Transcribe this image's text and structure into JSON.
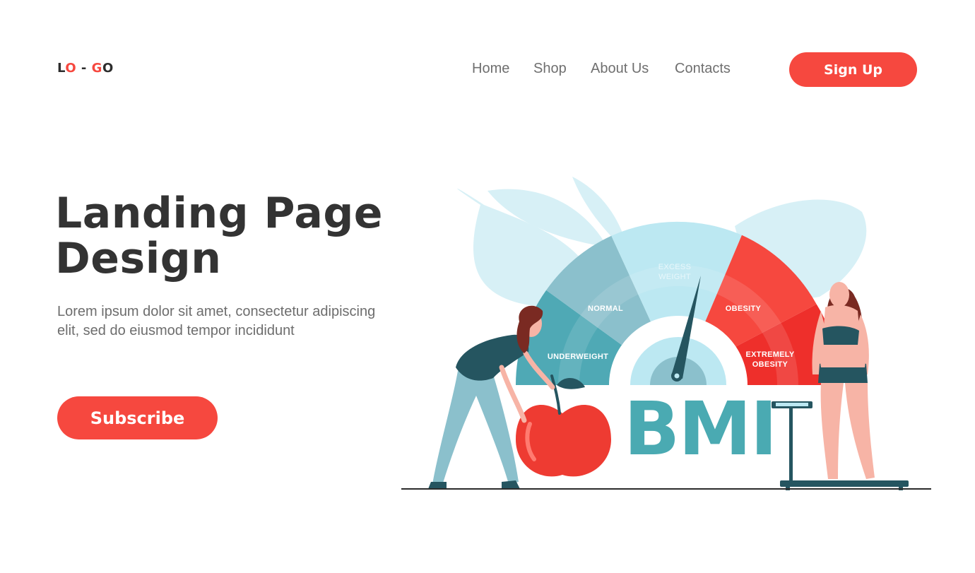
{
  "header": {
    "logo": {
      "part1": "L",
      "part2": "O",
      "part3": " - ",
      "part4": "G",
      "part5": "O"
    },
    "nav": [
      {
        "label": "Home"
      },
      {
        "label": "Shop"
      },
      {
        "label": "About Us"
      },
      {
        "label": "Contacts"
      }
    ],
    "signup_label": "Sign Up"
  },
  "hero": {
    "title_line1": "Landing Page",
    "title_line2": "Design",
    "description_line1": "Lorem ipsum dolor sit amet, consectetur adipiscing",
    "description_line2": "elit, sed do eiusmod tempor incididunt",
    "subscribe_label": "Subscribe"
  },
  "illustration": {
    "bmi_text": "BMI",
    "gauge_labels": {
      "underweight": "UNDERWEIGHT",
      "normal": "NORMAL",
      "excess_line1": "EXCESS",
      "excess_line2": "WEIGHT",
      "obesity": "OBESITY",
      "extreme_line1": "EXTREMELY",
      "extreme_line2": "OBESITY"
    }
  },
  "colors": {
    "accent": "#f6483f",
    "heading": "#333333",
    "body_text": "#6d6d6d",
    "nav_text": "#6f6f6f",
    "bmi_teal": "#4aaab2",
    "dark_teal": "#255560"
  }
}
